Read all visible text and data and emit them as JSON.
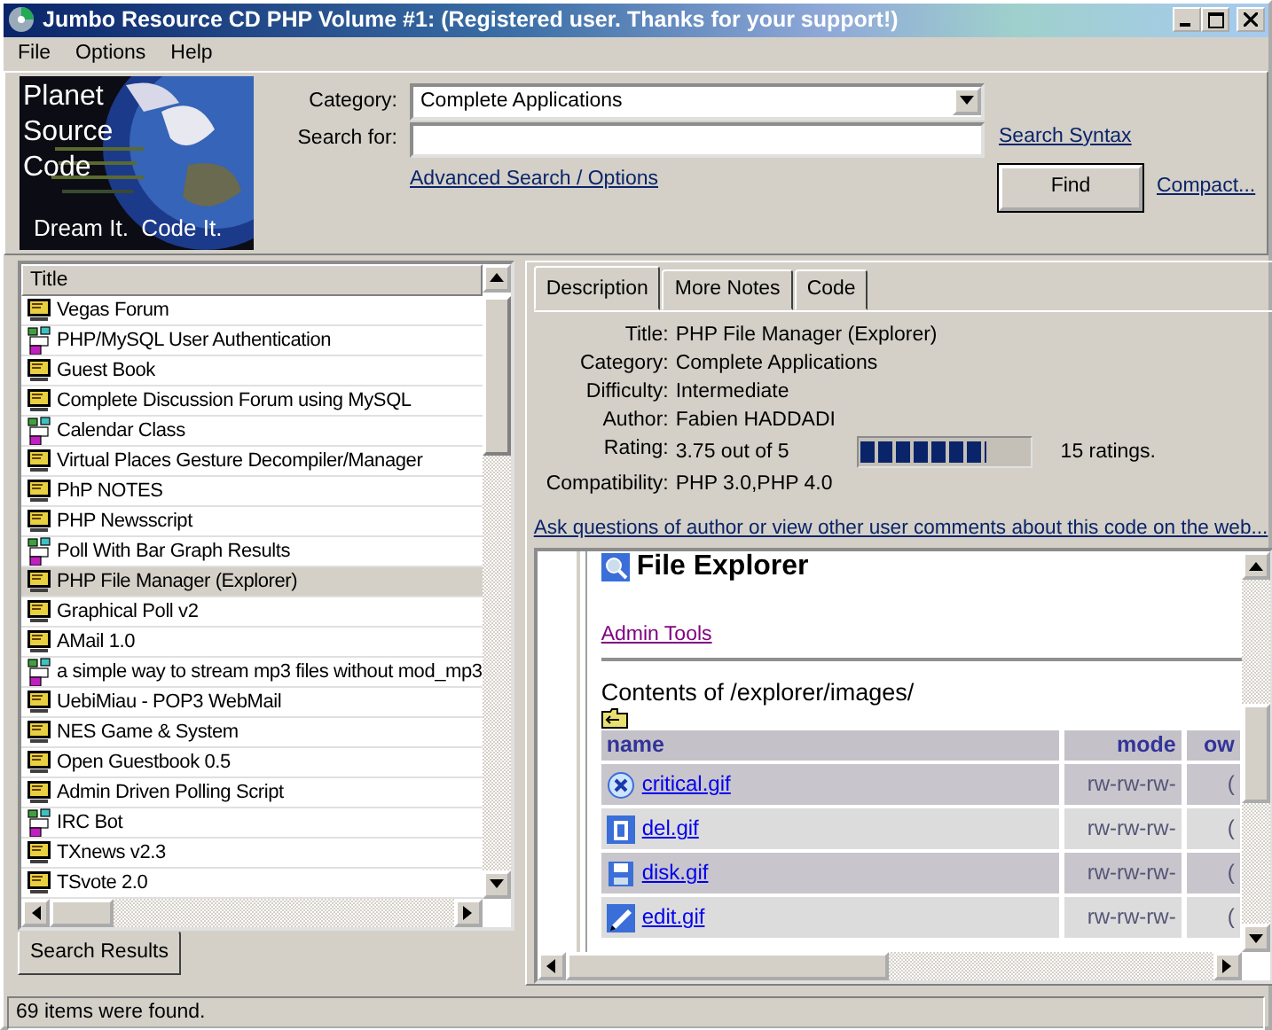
{
  "window": {
    "title": "Jumbo Resource CD PHP Volume #1: (Registered user.  Thanks for your support!)"
  },
  "menu": [
    "File",
    "Options",
    "Help"
  ],
  "logo": {
    "lines": [
      "Planet",
      "Source",
      "Code"
    ],
    "tagline": "Dream It.  Code It."
  },
  "search": {
    "category_label": "Category:",
    "category": "Complete Applications",
    "search_label": "Search for:",
    "syntax_link": "Search Syntax",
    "advanced_link": "Advanced Search / Options",
    "find_button": "Find",
    "compact_link": "Compact..."
  },
  "results": {
    "header": "Title",
    "items": [
      {
        "title": "Vegas Forum",
        "kind": "code",
        "selected": false
      },
      {
        "title": "PHP/MySQL User Authentication",
        "kind": "package",
        "selected": false
      },
      {
        "title": "Guest Book",
        "kind": "code",
        "selected": false
      },
      {
        "title": "Complete Discussion Forum using MySQL",
        "kind": "code",
        "selected": false
      },
      {
        "title": "Calendar Class",
        "kind": "package",
        "selected": false
      },
      {
        "title": "Virtual Places Gesture Decompiler/Manager",
        "kind": "code",
        "selected": false
      },
      {
        "title": "PhP NOTES",
        "kind": "code",
        "selected": false
      },
      {
        "title": "PHP Newsscript",
        "kind": "code",
        "selected": false
      },
      {
        "title": "Poll With Bar Graph Results",
        "kind": "package",
        "selected": false
      },
      {
        "title": "PHP File Manager (Explorer)",
        "kind": "code",
        "selected": true
      },
      {
        "title": "Graphical Poll v2",
        "kind": "code",
        "selected": false
      },
      {
        "title": "AMail 1.0",
        "kind": "code",
        "selected": false
      },
      {
        "title": "a simple way to stream mp3 files without mod_mp3",
        "kind": "package",
        "selected": false
      },
      {
        "title": "UebiMiau - POP3 WebMail",
        "kind": "code",
        "selected": false
      },
      {
        "title": "NES Game & System",
        "kind": "code",
        "selected": false
      },
      {
        "title": "Open Guestbook 0.5",
        "kind": "code",
        "selected": false
      },
      {
        "title": "Admin Driven Polling Script",
        "kind": "code",
        "selected": false
      },
      {
        "title": "IRC Bot",
        "kind": "package",
        "selected": false
      },
      {
        "title": "TXnews v2.3",
        "kind": "code",
        "selected": false
      },
      {
        "title": "TSvote 2.0",
        "kind": "code",
        "selected": false
      }
    ],
    "tab": "Search Results"
  },
  "details": {
    "tabs": [
      {
        "label": "Description",
        "selected": true
      },
      {
        "label": "More Notes",
        "selected": false
      },
      {
        "label": "Code",
        "selected": false
      }
    ],
    "fields": [
      {
        "kind": "text",
        "label": "Title:",
        "value": "PHP File Manager (Explorer)"
      },
      {
        "kind": "text",
        "label": "Category:",
        "value": "Complete Applications"
      },
      {
        "kind": "text",
        "label": "Difficulty:",
        "value": "Intermediate"
      },
      {
        "kind": "text",
        "label": "Author:",
        "value": "Fabien HADDADI"
      },
      {
        "kind": "rating",
        "label": "Rating:",
        "value": "3.75 out of 5",
        "level": 0.75,
        "count": "15 ratings."
      },
      {
        "kind": "text",
        "label": "Compatibility:",
        "value": "PHP 3.0,PHP 4.0"
      }
    ],
    "web_link": "Ask questions of author or view other user comments about this code on the web..."
  },
  "browser": {
    "heading": "File Explorer",
    "admin_link": "Admin Tools",
    "contents": "Contents of /explorer/images/",
    "table": {
      "columns": [
        "name",
        "mode",
        "ow"
      ],
      "rows": [
        {
          "kind": "critical",
          "cells": [
            "critical.gif",
            "rw-rw-rw-",
            "("
          ]
        },
        {
          "kind": "delete",
          "cells": [
            "del.gif",
            "rw-rw-rw-",
            "("
          ]
        },
        {
          "kind": "disk",
          "cells": [
            "disk.gif",
            "rw-rw-rw-",
            "("
          ]
        },
        {
          "kind": "edit",
          "cells": [
            "edit.gif",
            "rw-rw-rw-",
            "("
          ]
        }
      ]
    }
  },
  "status_bar": "69 items were found."
}
